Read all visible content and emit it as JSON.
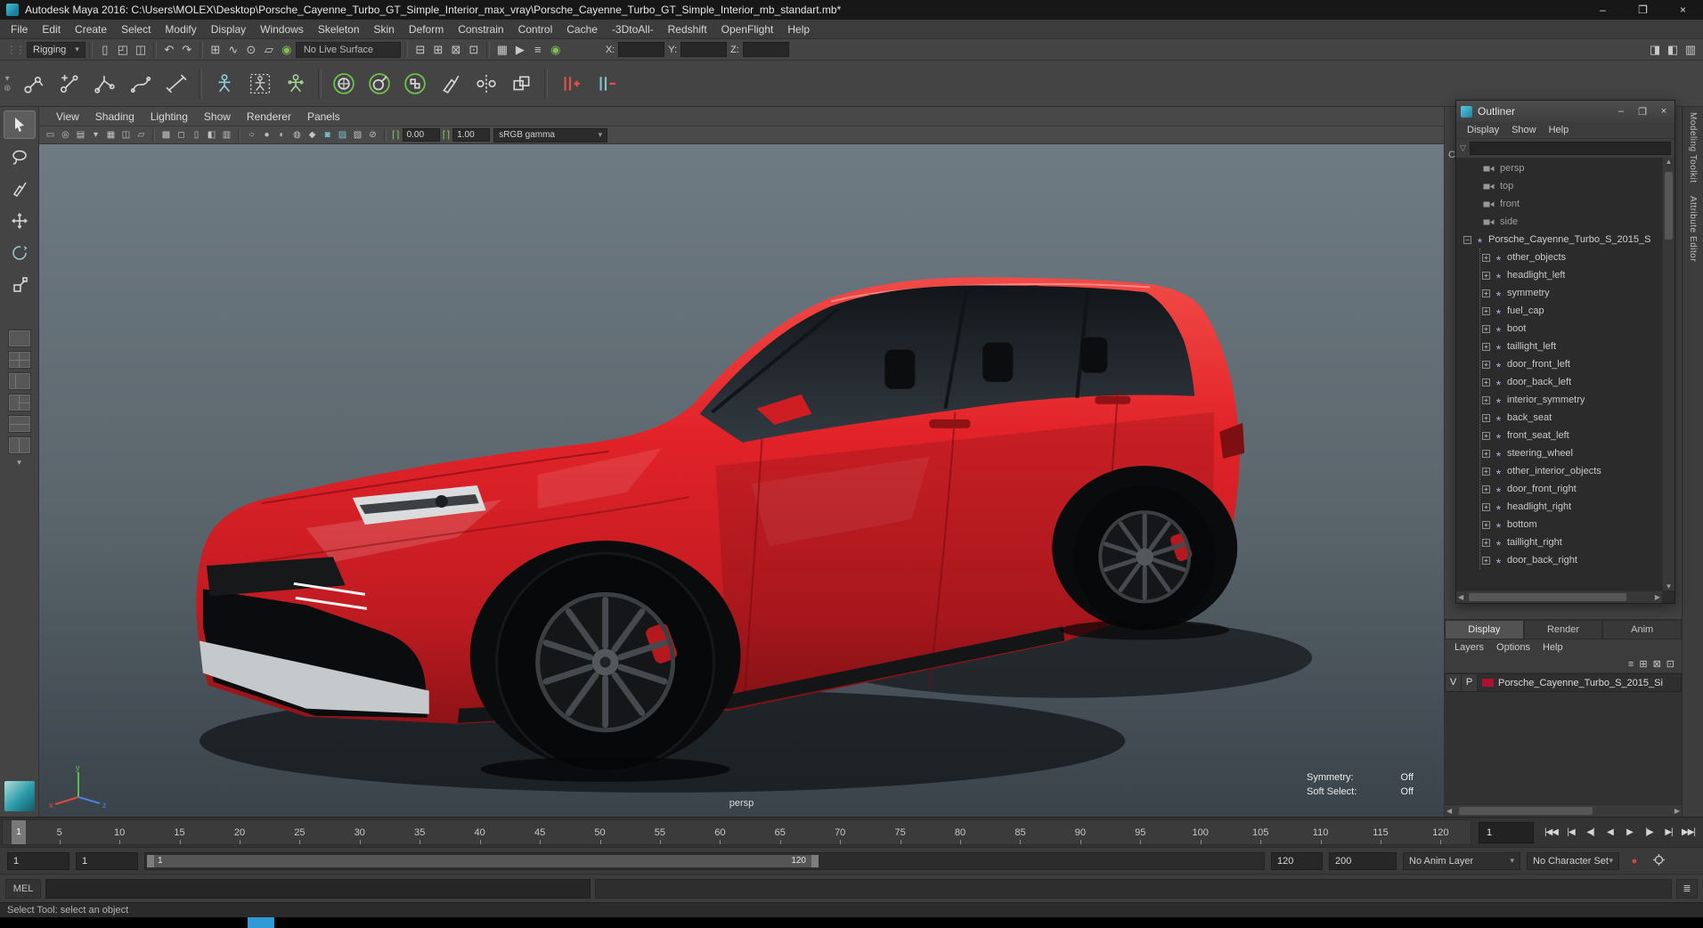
{
  "window": {
    "title": "Autodesk Maya 2016: C:\\Users\\MOLEX\\Desktop\\Porsche_Cayenne_Turbo_GT_Simple_Interior_max_vray\\Porsche_Cayenne_Turbo_GT_Simple_Interior_mb_standart.mb*",
    "minimize": "–",
    "maximize": "❐",
    "close": "×"
  },
  "menubar": [
    "File",
    "Edit",
    "Create",
    "Select",
    "Modify",
    "Display",
    "Windows",
    "Skeleton",
    "Skin",
    "Deform",
    "Constrain",
    "Control",
    "Cache",
    "-3DtoAll-",
    "Redshift",
    "OpenFlight",
    "Help"
  ],
  "statusline": {
    "menuset": "Rigging",
    "live_surface": "No Live Surface",
    "x_label": "X:",
    "y_label": "Y:",
    "z_label": "Z:",
    "file_icons": [
      {
        "name": "new-scene-icon",
        "glyph": "▯"
      },
      {
        "name": "open-scene-icon",
        "glyph": "◰"
      },
      {
        "name": "save-scene-icon",
        "glyph": "◫"
      }
    ],
    "history_icons": [
      {
        "name": "undo-icon",
        "glyph": "↶"
      },
      {
        "name": "redo-icon",
        "glyph": "↷"
      }
    ],
    "snap_icons": [
      {
        "name": "snap-to-grid-icon",
        "glyph": "⊞"
      },
      {
        "name": "snap-to-curve-icon",
        "glyph": "∿"
      },
      {
        "name": "snap-to-point-icon",
        "glyph": "⊙"
      },
      {
        "name": "snap-to-plane-icon",
        "glyph": "▱"
      },
      {
        "name": "make-live-icon",
        "glyph": "◉",
        "color": "#7ec052"
      }
    ],
    "mask_icons": [
      {
        "name": "selection-mask-hierarchy-icon",
        "glyph": "⊟"
      },
      {
        "name": "selection-mask-object-icon",
        "glyph": "⊞"
      },
      {
        "name": "selection-mask-component-icon",
        "glyph": "⊠"
      },
      {
        "name": "highlight-selection-mode-icon",
        "glyph": "⊡"
      }
    ],
    "render_icons": [
      {
        "name": "render-current-frame-icon",
        "glyph": "▦"
      },
      {
        "name": "ipr-render-icon",
        "glyph": "▶"
      },
      {
        "name": "render-settings-icon",
        "glyph": "≡"
      },
      {
        "name": "render-view-icon",
        "glyph": "◉",
        "color": "#7ec052"
      }
    ],
    "sidebar_icons": [
      {
        "name": "toggle-modeling-toolkit-icon",
        "glyph": "◨"
      },
      {
        "name": "toggle-attribute-editor-icon",
        "glyph": "◧"
      },
      {
        "name": "toggle-channel-box-icon",
        "glyph": "▥"
      }
    ]
  },
  "viewport": {
    "menus": [
      "View",
      "Shading",
      "Lighting",
      "Show",
      "Renderer",
      "Panels"
    ],
    "view_icons": [
      {
        "name": "select-camera-icon",
        "glyph": "▭"
      },
      {
        "name": "lock-camera-icon",
        "glyph": "◎"
      },
      {
        "name": "camera-attributes-icon",
        "glyph": "▤"
      },
      {
        "name": "bookmarks-icon",
        "glyph": "▾"
      },
      {
        "name": "image-plane-icon",
        "glyph": "▦"
      },
      {
        "name": "2d-pan-zoom-icon",
        "glyph": "◫"
      },
      {
        "name": "grease-pencil-icon",
        "glyph": "▱"
      }
    ],
    "gate_icons": [
      {
        "name": "grid-toggle-icon",
        "glyph": "▩"
      },
      {
        "name": "film-gate-icon",
        "glyph": "◻"
      },
      {
        "name": "resolution-gate-icon",
        "glyph": "▯"
      },
      {
        "name": "gate-mask-icon",
        "glyph": "◧"
      },
      {
        "name": "field-chart-icon",
        "glyph": "▥"
      }
    ],
    "shading_icons": [
      {
        "name": "wireframe-icon",
        "glyph": "○"
      },
      {
        "name": "shaded-icon",
        "glyph": "●"
      },
      {
        "name": "textured-icon",
        "glyph": "◐"
      },
      {
        "name": "use-all-lights-icon",
        "glyph": "◍"
      },
      {
        "name": "shadows-icon",
        "glyph": "◆"
      },
      {
        "name": "screen-space-ao-icon",
        "glyph": "◙",
        "color": "#7fc4c9"
      },
      {
        "name": "motion-blur-icon",
        "glyph": "▨",
        "color": "#7fc4c9"
      },
      {
        "name": "multisampling-icon",
        "glyph": "▧"
      },
      {
        "name": "isolate-select-icon",
        "glyph": "⊘"
      }
    ],
    "exposure_icon": "⌈⌉",
    "gamma_icon": "⌈⌉",
    "exposure": "0.00",
    "gamma": "1.00",
    "colorspace": "sRGB gamma",
    "camera_label": "persp",
    "symmetry_label": "Symmetry:",
    "symmetry_value": "Off",
    "soft_select_label": "Soft Select:",
    "soft_select_value": "Off",
    "axis_x": "x",
    "axis_y": "y",
    "axis_z": "z"
  },
  "outliner": {
    "title": "Outliner",
    "menus": [
      "Display",
      "Show",
      "Help"
    ],
    "cameras": [
      "persp",
      "top",
      "front",
      "side"
    ],
    "root_item": "Porsche_Cayenne_Turbo_S_2015_S",
    "children": [
      "other_objects",
      "headlight_left",
      "symmetry",
      "fuel_cap",
      "boot",
      "taillight_left",
      "door_front_left",
      "door_back_left",
      "interior_symmetry",
      "back_seat",
      "front_seat_left",
      "steering_wheel",
      "other_interior_objects",
      "door_front_right",
      "headlight_right",
      "bottom",
      "taillight_right",
      "door_back_right"
    ]
  },
  "layer_editor": {
    "tabs": [
      "Display",
      "Render",
      "Anim"
    ],
    "menus": [
      "Layers",
      "Options",
      "Help"
    ],
    "toolbar_icons": [
      {
        "name": "layer-options-icon",
        "glyph": "≡"
      },
      {
        "name": "new-empty-layer-icon",
        "glyph": "⊞"
      },
      {
        "name": "new-layer-from-selected-icon",
        "glyph": "⊠"
      },
      {
        "name": "layer-list-icon",
        "glyph": "⊡"
      }
    ],
    "layer": {
      "visibility": "V",
      "playback": "P",
      "name": "Porsche_Cayenne_Turbo_S_2015_Si"
    }
  },
  "side_tabs": [
    {
      "label": "Modeling Toolkit"
    },
    {
      "label": "Attribute Editor"
    }
  ],
  "channel_box_partial": "C",
  "timeline": {
    "marker": "1",
    "frame_field": "1",
    "ticks": [
      "5",
      "10",
      "15",
      "20",
      "25",
      "30",
      "35",
      "40",
      "45",
      "50",
      "55",
      "60",
      "65",
      "70",
      "75",
      "80",
      "85",
      "90",
      "95",
      "100",
      "105",
      "110",
      "115",
      "120"
    ],
    "transport": [
      {
        "name": "go-to-start-button",
        "glyph": "|◀◀"
      },
      {
        "name": "step-back-frame-button",
        "glyph": "|◀"
      },
      {
        "name": "step-back-key-button",
        "glyph": "◀|"
      },
      {
        "name": "play-backwards-button",
        "glyph": "◀"
      },
      {
        "name": "play-forwards-button",
        "glyph": "▶"
      },
      {
        "name": "step-forward-key-button",
        "glyph": "|▶"
      },
      {
        "name": "step-forward-frame-button",
        "glyph": "▶|"
      },
      {
        "name": "go-to-end-button",
        "glyph": "▶▶|"
      }
    ]
  },
  "range_slider": {
    "anim_start": "1",
    "playback_start": "1",
    "bar_start_label": "1",
    "bar_end_label": "120",
    "playback_end": "120",
    "anim_end": "200",
    "anim_layer": "No Anim Layer",
    "character_set": "No Character Set"
  },
  "command_line": {
    "label": "MEL"
  },
  "help_line": {
    "text": "Select Tool: select an object"
  },
  "icons": {
    "expand": "+",
    "collapse": "−",
    "transform_node": "*",
    "dropdown_arrow": "▾",
    "search": "▽",
    "grip": "⋮⋮",
    "scroll_up": "▲",
    "scroll_down": "▼",
    "scroll_left": "◀",
    "scroll_right": "▶",
    "auto_key": "●",
    "script_editor": "≣",
    "shelf_menu": "▾",
    "shelf_gear": "⊕"
  },
  "colors": {
    "car_red": "#e02128",
    "layer_swatch": "#b01030",
    "taskbar_blue": "#2f9ad8",
    "accent_green": "#7ec052"
  }
}
